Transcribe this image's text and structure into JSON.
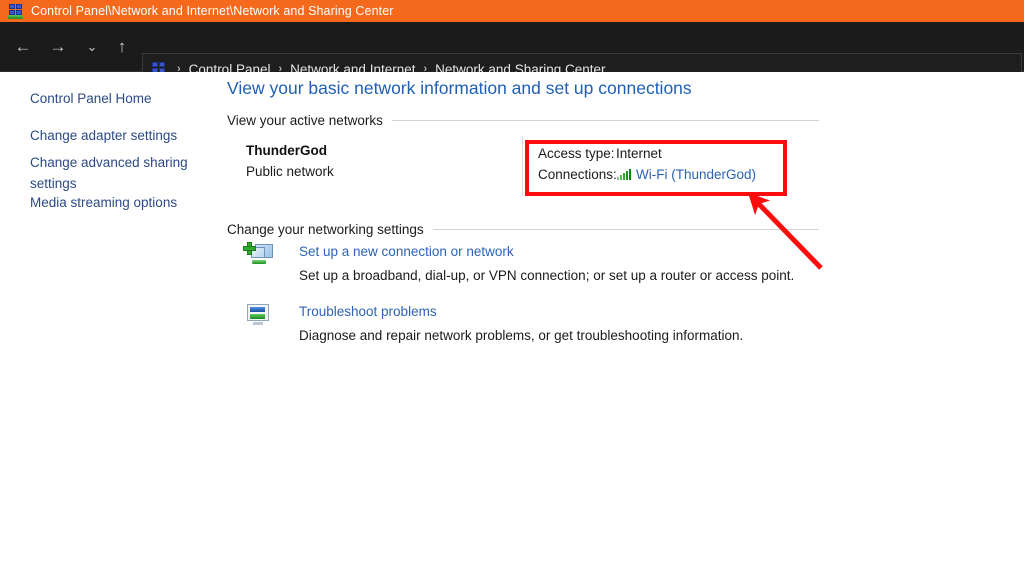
{
  "window": {
    "title": "Control Panel\\Network and Internet\\Network and Sharing Center",
    "icon": "control-panel-network-icon"
  },
  "toolbar": {
    "back_icon": "←",
    "forward_icon": "→",
    "recent_icon": "⌄",
    "up_icon": "↑",
    "breadcrumb": {
      "icon": "control-panel-network-icon",
      "separator": "›",
      "items": [
        "Control Panel",
        "Network and Internet",
        "Network and Sharing Center"
      ]
    }
  },
  "sidebar": {
    "items": [
      {
        "label": "Control Panel Home"
      },
      {
        "label": "Change adapter settings"
      },
      {
        "label": "Change advanced sharing settings"
      },
      {
        "label": "Media streaming options"
      }
    ]
  },
  "main": {
    "heading": "View your basic network information and set up connections",
    "sections": {
      "active_networks": {
        "label": "View your active networks",
        "network": {
          "name": "ThunderGod",
          "type": "Public network",
          "access_type_label": "Access type:",
          "access_type_value": "Internet",
          "connections_label": "Connections:",
          "connections_icon": "wifi-signal-bars-icon",
          "connections_value": "Wi-Fi (ThunderGod)"
        }
      },
      "networking_settings": {
        "label": "Change your networking settings",
        "tasks": [
          {
            "icon": "new-connection-icon",
            "title": "Set up a new connection or network",
            "description": "Set up a broadband, dial-up, or VPN connection; or set up a router or access point."
          },
          {
            "icon": "troubleshoot-icon",
            "title": "Troubleshoot problems",
            "description": "Diagnose and repair network problems, or get troubleshooting information."
          }
        ]
      }
    }
  },
  "annotations": {
    "highlight_color": "#fb0d0d",
    "arrow_color": "#fb0d0d",
    "highlight_target": "connections-details",
    "arrow_points_to": "connections-details"
  },
  "colors": {
    "titlebar": "#f4691c",
    "toolbar": "#1b1b1b",
    "heading": "#1f5fb4",
    "link": "#2c63b5",
    "sidebar_link": "#2b4a86"
  }
}
